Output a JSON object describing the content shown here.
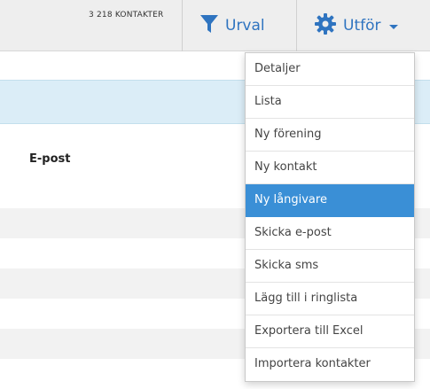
{
  "toolbar": {
    "contact_count": "3 218 KONTAKTER",
    "urval_label": "Urval",
    "utfor_label": "Utför",
    "filter_icon": "filter-icon",
    "gear_icon": "gear-icon",
    "accent_color": "#2f74c0"
  },
  "table": {
    "column_email": "E-post"
  },
  "menu": {
    "items": [
      {
        "label": "Detaljer"
      },
      {
        "label": "Lista"
      },
      {
        "label": "Ny förening"
      },
      {
        "label": "Ny kontakt"
      },
      {
        "label": "Ny långivare",
        "active": true
      },
      {
        "label": "Skicka e-post"
      },
      {
        "label": "Skicka sms"
      },
      {
        "label": "Lägg till i ringlista"
      },
      {
        "label": "Exportera till Excel"
      },
      {
        "label": "Importera kontakter"
      }
    ],
    "highlight_color": "#3a8fd6"
  }
}
